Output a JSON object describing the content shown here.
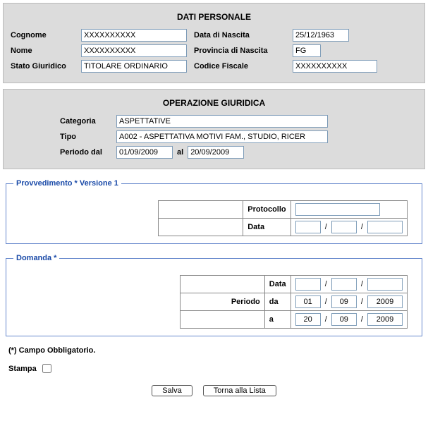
{
  "personal": {
    "title": "DATI PERSONALE",
    "labels": {
      "cognome": "Cognome",
      "nome": "Nome",
      "stato": "Stato Giuridico",
      "data_nascita": "Data di Nascita",
      "provincia": "Provincia di Nascita",
      "codice_fiscale": "Codice Fiscale"
    },
    "values": {
      "cognome": "XXXXXXXXXX",
      "nome": "XXXXXXXXXX",
      "stato": "TITOLARE ORDINARIO",
      "data_nascita": "25/12/1963",
      "provincia": "FG",
      "codice_fiscale": "XXXXXXXXXX"
    }
  },
  "operazione": {
    "title": "OPERAZIONE GIURIDICA",
    "labels": {
      "categoria": "Categoria",
      "tipo": "Tipo",
      "periodo_dal": "Periodo dal",
      "al": "al"
    },
    "values": {
      "categoria": "ASPETTATIVE",
      "tipo": "A002 - ASPETTATIVA MOTIVI FAM., STUDIO, RICER",
      "dal": "01/09/2009",
      "al": "20/09/2009"
    }
  },
  "provvedimento": {
    "legend": "Provvedimento * Versione 1",
    "labels": {
      "protocollo": "Protocollo",
      "data": "Data"
    },
    "values": {
      "protocollo": "",
      "data_d": "",
      "data_m": "",
      "data_y": ""
    }
  },
  "domanda": {
    "legend": "Domanda *",
    "labels": {
      "data": "Data",
      "periodo": "Periodo",
      "da": "da",
      "a": "a"
    },
    "values": {
      "data_d": "",
      "data_m": "",
      "data_y": "",
      "da_d": "01",
      "da_m": "09",
      "da_y": "2009",
      "a_d": "20",
      "a_m": "09",
      "a_y": "2009"
    }
  },
  "footer": {
    "note": "(*) Campo Obbligatorio.",
    "stampa_label": "Stampa",
    "btn_salva": "Salva",
    "btn_torna": "Torna alla Lista"
  },
  "slash": "/"
}
